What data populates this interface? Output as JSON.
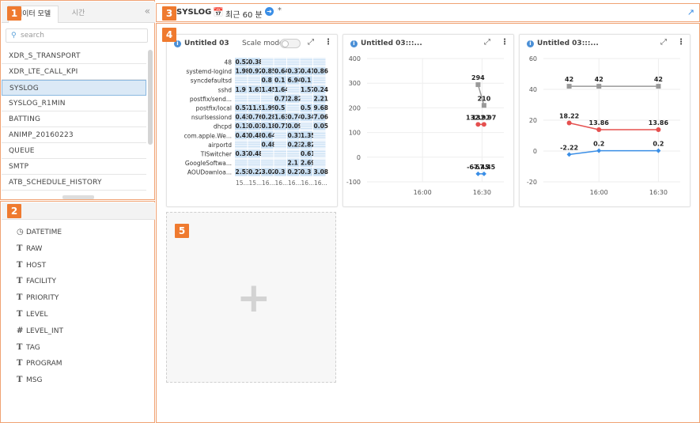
{
  "badges": [
    "1",
    "2",
    "3",
    "4",
    "5"
  ],
  "left_panel": {
    "tabs": [
      {
        "label": "데이터 모델"
      },
      {
        "label": "시간"
      }
    ],
    "collapse": "«",
    "search_placeholder": "search",
    "items": [
      {
        "label": "XDR_S_TRANSPORT"
      },
      {
        "label": "XDR_LTE_CALL_KPI"
      },
      {
        "label": "SYSLOG",
        "selected": true
      },
      {
        "label": "SYSLOG_R1MIN"
      },
      {
        "label": "BATTING"
      },
      {
        "label": "ANIMP_20160223"
      },
      {
        "label": "QUEUE"
      },
      {
        "label": "SMTP"
      },
      {
        "label": "ATB_SCHEDULE_HISTORY"
      }
    ]
  },
  "fields_panel": {
    "fields": [
      {
        "label": "DATETIME",
        "type_icon": "clock-icon",
        "glyph": "◷"
      },
      {
        "label": "RAW",
        "type_icon": "text-type-icon",
        "glyph": "T"
      },
      {
        "label": "HOST",
        "type_icon": "text-type-icon",
        "glyph": "T"
      },
      {
        "label": "FACILITY",
        "type_icon": "text-type-icon",
        "glyph": "T"
      },
      {
        "label": "PRIORITY",
        "type_icon": "text-type-icon",
        "glyph": "T"
      },
      {
        "label": "LEVEL",
        "type_icon": "text-type-icon",
        "glyph": "T"
      },
      {
        "label": "LEVEL_INT",
        "type_icon": "number-type-icon",
        "glyph": "#"
      },
      {
        "label": "TAG",
        "type_icon": "text-type-icon",
        "glyph": "T"
      },
      {
        "label": "PROGRAM",
        "type_icon": "text-type-icon",
        "glyph": "T"
      },
      {
        "label": "MSG",
        "type_icon": "text-type-icon",
        "glyph": "T"
      }
    ]
  },
  "topbar": {
    "title": "SYSLOG",
    "time_range": "최근 60 분",
    "star": "*",
    "icons": {
      "calendar": "calendar-icon",
      "go": "arrow-right-circle-icon",
      "share": "share-icon"
    }
  },
  "cards": [
    {
      "title": "Untitled 03",
      "scale_mode_label": "Scale mode"
    },
    {
      "title": "Untitled 03:::..."
    },
    {
      "title": "Untitled 03:::..."
    }
  ],
  "colors": {
    "accent": "#ef7a2f",
    "blue": "#4a90d9",
    "grey_series": "#999999",
    "red_series": "#e5504f",
    "blue_series": "#3a8ee6",
    "heat": "#cfe3f5"
  },
  "chart_data": [
    {
      "type": "heatmap",
      "rows": [
        "48",
        "systemd-logind",
        "syncdefaultsd",
        "sshd",
        "postfix/send...",
        "postfix/local",
        "nsurlsessiond",
        "dhcpd",
        "com.apple.We...",
        "airportd",
        "TISwitcher",
        "GoogleSoftwa...",
        "AOUDownloa..."
      ],
      "x_labels": [
        "15...",
        "15...",
        "16...",
        "16...",
        "16...",
        "16...",
        "16..."
      ],
      "cells": [
        [
          "0.52",
          "0.38",
          "",
          "",
          "",
          "",
          ""
        ],
        [
          "1.98",
          "0.92",
          "0.85",
          "0.64",
          "0.37",
          "0.41",
          "0.86"
        ],
        [
          "",
          "",
          "0.8",
          "0.1",
          "6.94",
          "0.1",
          ""
        ],
        [
          "1.9",
          "1.61",
          "1.45",
          "1.64",
          "",
          "1.57",
          "0.24"
        ],
        [
          "",
          "",
          "",
          "0.71",
          "2.82",
          "",
          "2.21"
        ],
        [
          "0.57",
          "11.9",
          "1.99",
          "0.5",
          "",
          "0.5",
          "9.68"
        ],
        [
          "0.43",
          "0.76",
          "0.28",
          "1.63",
          "0.74",
          "0.34",
          "7.06"
        ],
        [
          "0.13",
          "0.03",
          "0.18",
          "0.71",
          "0.09",
          "",
          "0.05"
        ],
        [
          "0.41",
          "0.48",
          "0.64",
          "",
          "0.31",
          "1.35",
          ""
        ],
        [
          "",
          "",
          "0.48",
          "",
          "0.23",
          "2.82",
          ""
        ],
        [
          "0.37",
          "0.48",
          "",
          "",
          "",
          "0.61",
          ""
        ],
        [
          "",
          "",
          "",
          "",
          "2.1",
          "2.69",
          ""
        ],
        [
          "2.53",
          "0.22",
          "3.02",
          "0.3",
          "0.27",
          "0.3",
          "3.08"
        ]
      ]
    },
    {
      "type": "line",
      "ylim": [
        -100,
        400
      ],
      "yticks": [
        "400",
        "300",
        "200",
        "100",
        "0",
        "-100"
      ],
      "xticks": [
        "16:00",
        "16:30"
      ],
      "series": [
        {
          "color": "#999999",
          "marker": "square",
          "points": [
            {
              "x": "16:28",
              "y": 294
            },
            {
              "x": "16:31",
              "y": 210
            }
          ],
          "labels": [
            "294",
            "210"
          ]
        },
        {
          "color": "#e5504f",
          "marker": "circle",
          "points": [
            {
              "x": "16:28",
              "y": 132.97
            },
            {
              "x": "16:31",
              "y": 132.97
            }
          ],
          "labels": [
            "132.97",
            "132.97"
          ]
        },
        {
          "color": "#3a8ee6",
          "marker": "diamond",
          "points": [
            {
              "x": "16:28",
              "y": -67.45
            },
            {
              "x": "16:31",
              "y": -67.45
            }
          ],
          "labels": [
            "-67.45",
            "-67.45"
          ]
        }
      ]
    },
    {
      "type": "line",
      "ylim": [
        -20,
        60
      ],
      "yticks": [
        "60",
        "40",
        "20",
        "0",
        "-20"
      ],
      "xticks": [
        "16:00",
        "16:30"
      ],
      "series": [
        {
          "color": "#999999",
          "marker": "square",
          "points": [
            {
              "x": "15:45",
              "y": 42
            },
            {
              "x": "16:00",
              "y": 42
            },
            {
              "x": "16:30",
              "y": 42
            }
          ],
          "labels": [
            "42",
            "42",
            "42"
          ]
        },
        {
          "color": "#e5504f",
          "marker": "circle",
          "points": [
            {
              "x": "15:45",
              "y": 18.22
            },
            {
              "x": "16:00",
              "y": 13.86
            },
            {
              "x": "16:30",
              "y": 13.86
            }
          ],
          "labels": [
            "18.22",
            "13.86",
            "13.86"
          ]
        },
        {
          "color": "#3a8ee6",
          "marker": "diamond",
          "points": [
            {
              "x": "15:45",
              "y": -2.22
            },
            {
              "x": "16:00",
              "y": 0.2
            },
            {
              "x": "16:30",
              "y": 0.2
            }
          ],
          "labels": [
            "-2.22",
            "0.2",
            "0.2"
          ]
        }
      ]
    }
  ],
  "add_card": {
    "plus": "+"
  }
}
